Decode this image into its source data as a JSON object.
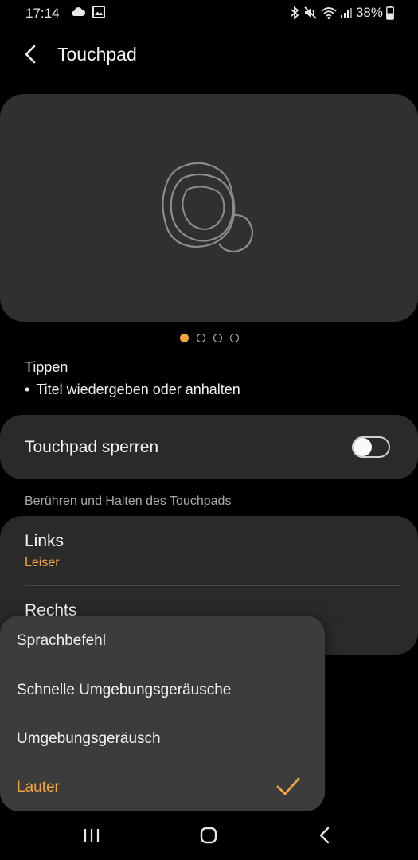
{
  "status_bar": {
    "time": "17:14",
    "left_icons": [
      "cloud-icon",
      "image-icon"
    ],
    "right_icons": [
      "bluetooth-icon",
      "mute-icon",
      "wifi-icon",
      "signal-icon"
    ],
    "battery": "38%"
  },
  "header": {
    "title": "Touchpad",
    "back_icon": "back-arrow-icon"
  },
  "illustration": {
    "icon": "earbud-icon",
    "page_count": 4,
    "active_page": 1
  },
  "tap_info": {
    "title": "Tippen",
    "description": "Titel wiedergeben oder anhalten"
  },
  "lock": {
    "label": "Touchpad sperren",
    "enabled": false
  },
  "touch_hold": {
    "section_title": "Berühren und Halten des Touchpads",
    "left": {
      "label": "Links",
      "value": "Leiser"
    },
    "right": {
      "label": "Rechts"
    }
  },
  "menu": {
    "items": [
      {
        "label": "Sprachbefehl",
        "selected": false
      },
      {
        "label": "Schnelle Umgebungsgeräusche",
        "selected": false
      },
      {
        "label": "Umgebungsgeräusch",
        "selected": false
      },
      {
        "label": "Lauter",
        "selected": true
      }
    ],
    "accent": "#f2a640"
  },
  "nav_bar": {
    "buttons": [
      "recents-icon",
      "home-icon",
      "back-icon"
    ]
  },
  "colors": {
    "accent": "#f2a640",
    "background": "#000000",
    "card": "#2a2a2a"
  }
}
